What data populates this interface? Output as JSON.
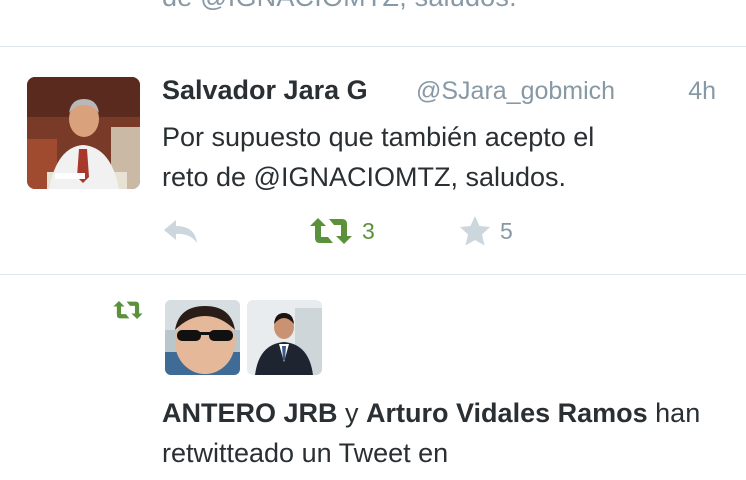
{
  "previous_tweet": {
    "text_fragment": "de @IGNACIOMTZ, saludos."
  },
  "tweet": {
    "display_name": "Salvador Jara G",
    "handle": "@SJara_gobmich",
    "timestamp": "4h",
    "text_line1": "Por supuesto que también acepto el",
    "text_line2": "reto de @IGNACIOMTZ, saludos.",
    "actions": {
      "reply_icon": "reply-icon",
      "retweet_icon": "retweet-icon",
      "retweet_count": "3",
      "favorite_icon": "star-icon",
      "favorite_count": "5"
    }
  },
  "retweet_activity": {
    "icon": "retweet-icon",
    "user1": "ANTERO JRB",
    "connector": "y",
    "user2": "Arturo Vidales Ramos",
    "suffix": "han retwitteado un Tweet en"
  },
  "colors": {
    "text": "#292f33",
    "muted": "#8899a6",
    "retweet_green": "#5c913b",
    "divider": "#e1e8ed"
  }
}
